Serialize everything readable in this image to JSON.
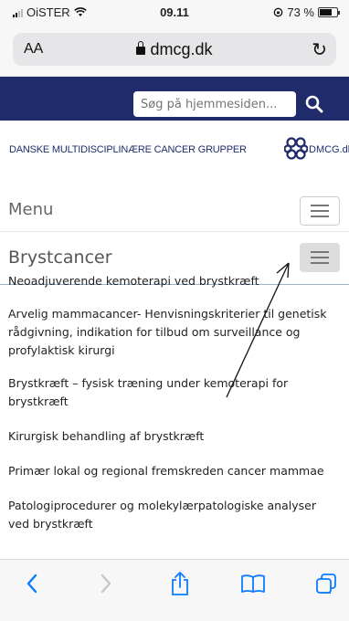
{
  "status_bar": {
    "carrier": "OiSTER",
    "time": "09.11",
    "battery_percent": "73 %",
    "battery_level": 0.73
  },
  "browser": {
    "text_size_label": "AA",
    "url": "dmcg.dk",
    "icons": [
      "lock-icon",
      "reload-icon"
    ]
  },
  "site": {
    "search_placeholder": "Søg på hjemmesiden...",
    "logo_text": "DANSKE MULTIDISCIPLINÆRE CANCER GRUPPER",
    "logo_abbr": "DMCG.dk",
    "brand_color": "#1f2b6b"
  },
  "nav": {
    "menu_label": "Menu",
    "section_label": "Brystcancer"
  },
  "links": [
    "Neoadjuverende kemoterapi ved brystkræft",
    "Arvelig mammacancer- Henvisningskriterier til genetisk rådgivning, indikation for tilbud om surveillance og profylaktisk kirurgi",
    "Brystkræft – fysisk træning under kemoterapi for brystkræft",
    "Kirurgisk behandling af brystkræft",
    "Primær lokal og regional fremskreden cancer mammae",
    "Patologiprocedurer og molekylærpatologiske analyser ved brystkræft"
  ],
  "toolbar": {
    "icons": [
      "back-icon",
      "forward-icon",
      "share-icon",
      "bookmarks-icon",
      "tabs-icon"
    ]
  }
}
